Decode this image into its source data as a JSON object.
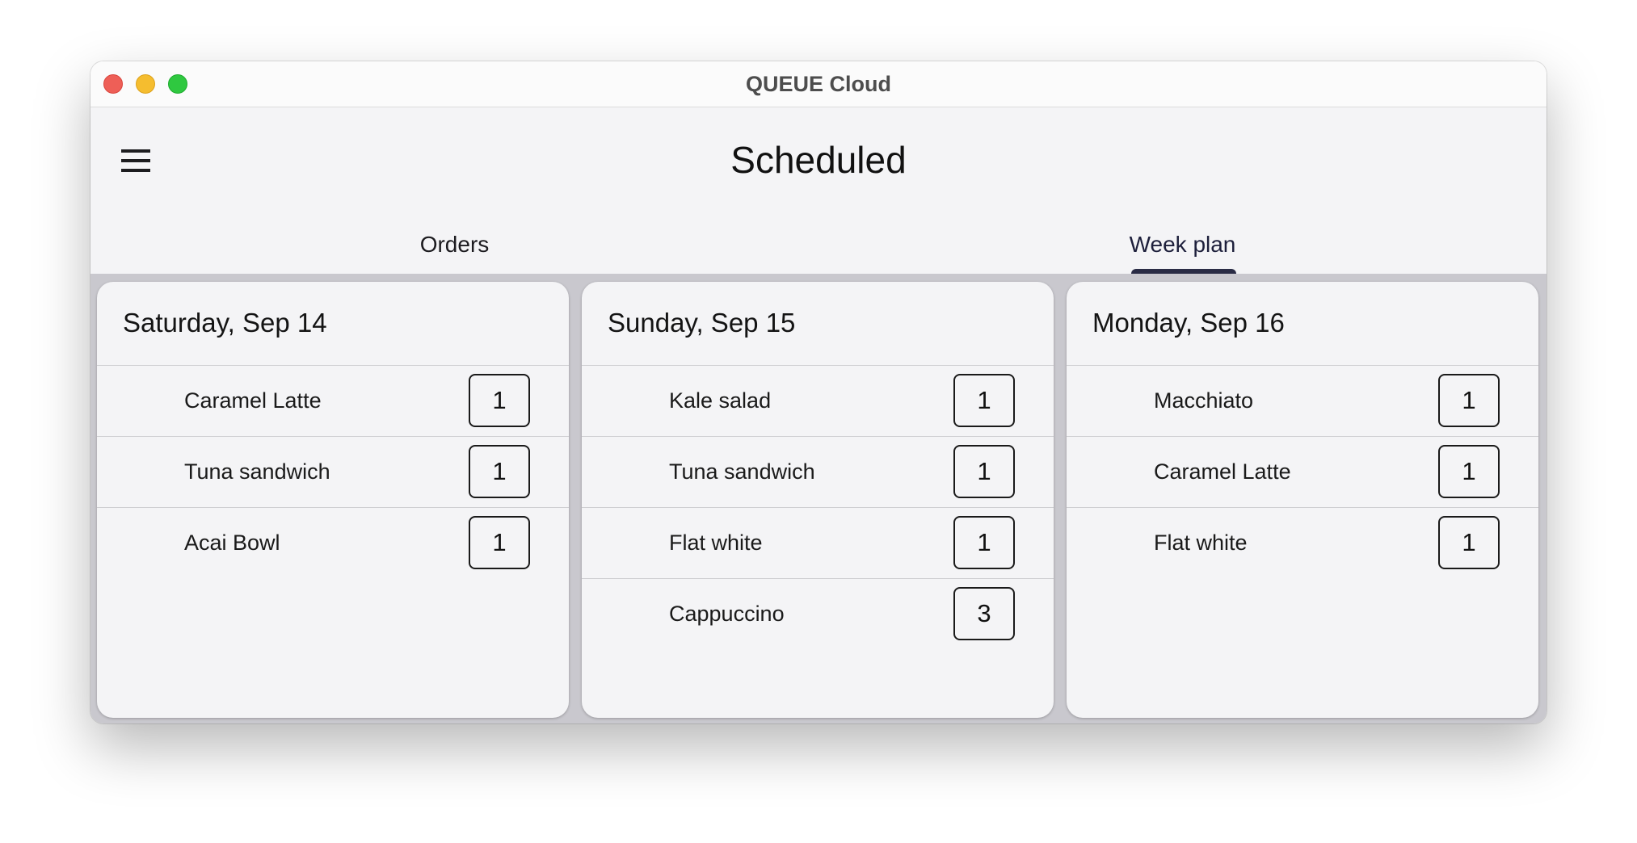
{
  "window": {
    "title": "QUEUE Cloud"
  },
  "appbar": {
    "title": "Scheduled",
    "menu_icon": "hamburger-menu-icon"
  },
  "tabs": [
    {
      "label": "Orders",
      "selected": false
    },
    {
      "label": "Week plan",
      "selected": true
    }
  ],
  "colors": {
    "accent": "#2a2c45",
    "background": "#f4f4f6",
    "content_background": "#c9c8ce"
  },
  "days": [
    {
      "title": "Saturday, Sep 14",
      "items": [
        {
          "name": "Caramel Latte",
          "qty": "1"
        },
        {
          "name": "Tuna sandwich",
          "qty": "1"
        },
        {
          "name": "Acai Bowl",
          "qty": "1"
        }
      ]
    },
    {
      "title": "Sunday, Sep 15",
      "items": [
        {
          "name": "Kale salad",
          "qty": "1"
        },
        {
          "name": "Tuna sandwich",
          "qty": "1"
        },
        {
          "name": "Flat white",
          "qty": "1"
        },
        {
          "name": "Cappuccino",
          "qty": "3"
        }
      ]
    },
    {
      "title": "Monday, Sep 16",
      "items": [
        {
          "name": "Macchiato",
          "qty": "1"
        },
        {
          "name": "Caramel Latte",
          "qty": "1"
        },
        {
          "name": "Flat white",
          "qty": "1"
        }
      ]
    }
  ]
}
